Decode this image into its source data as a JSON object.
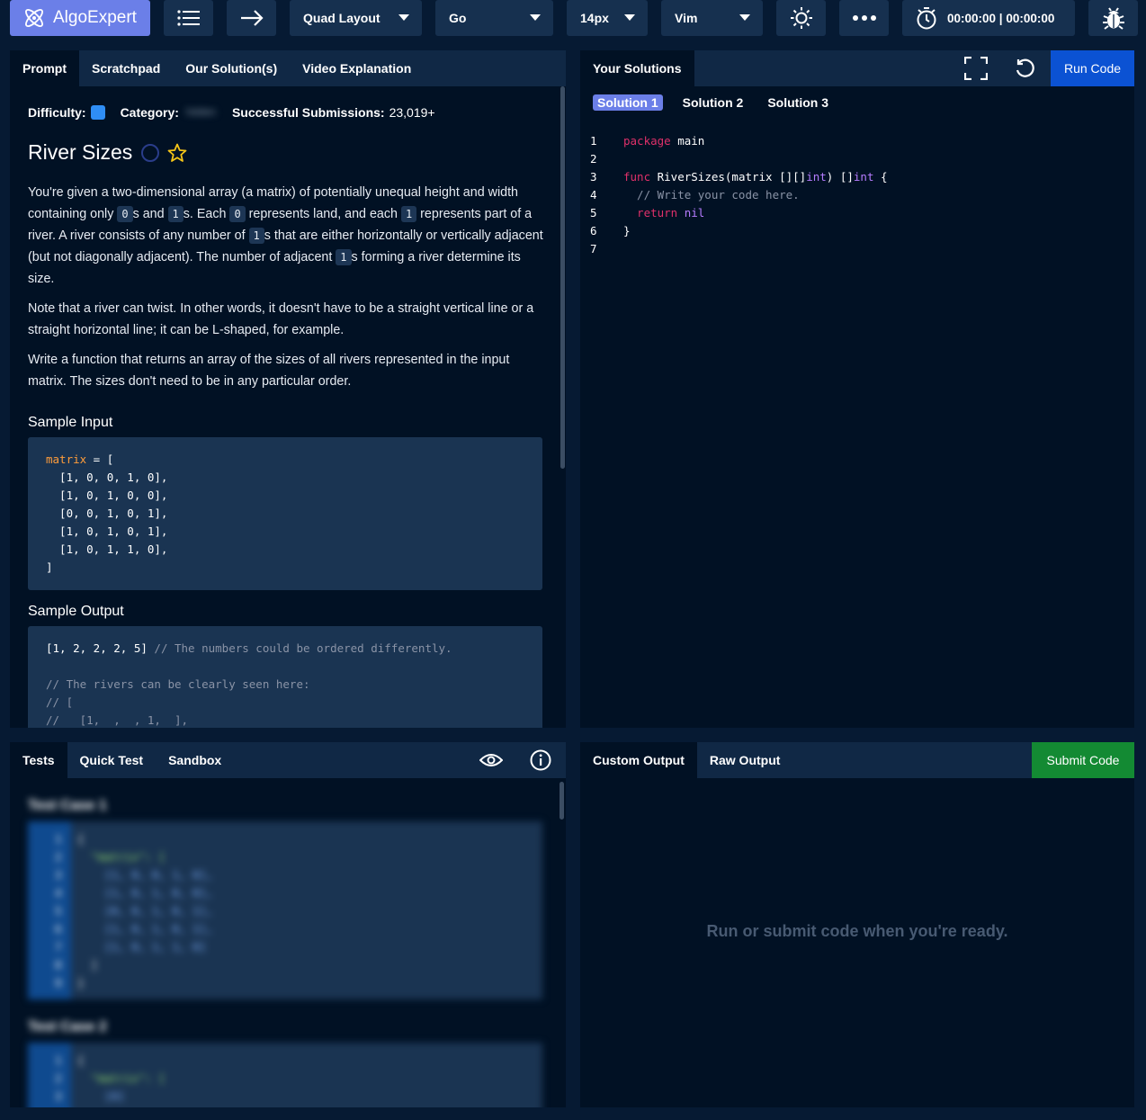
{
  "topbar": {
    "logo": "AlgoExpert",
    "layout": "Quad Layout",
    "language": "Go",
    "font_size": "14px",
    "keymap": "Vim",
    "timer": "00:00:00 | 00:00:00"
  },
  "prompt_panel": {
    "tabs": [
      "Prompt",
      "Scratchpad",
      "Our Solution(s)",
      "Video Explanation"
    ],
    "difficulty_label": "Difficulty:",
    "category_label": "Category:",
    "category_value": "hidden",
    "submissions_label": "Successful Submissions:",
    "submissions_value": "23,019+",
    "title": "River Sizes",
    "p1": {
      "a": "You're given a two-dimensional array (a matrix) of potentially unequal height and width containing only ",
      "c0": "0",
      "b": "s and ",
      "c1": "1",
      "c": "s. Each ",
      "c2": "0",
      "d": " represents land, and each ",
      "c3": "1",
      "e": " represents part of a river. A river consists of any number of ",
      "c4": "1",
      "f": "s that are either horizontally or vertically adjacent (but not diagonally adjacent). The number of adjacent ",
      "c5": "1",
      "g": "s forming a river determine its size."
    },
    "p2": "Note that a river can twist. In other words, it doesn't have to be a straight vertical line or a straight horizontal line; it can be L-shaped, for example.",
    "p3": "Write a function that returns an array of the sizes of all rivers represented in the input matrix. The sizes don't need to be in any particular order.",
    "sample_input_heading": "Sample Input",
    "sample_input": {
      "var": "matrix",
      "eq": " = [",
      "rows": [
        "  [1, 0, 0, 1, 0],",
        "  [1, 0, 1, 0, 0],",
        "  [0, 0, 1, 0, 1],",
        "  [1, 0, 1, 0, 1],",
        "  [1, 0, 1, 1, 0],"
      ],
      "close": "]"
    },
    "sample_output_heading": "Sample Output",
    "sample_output": {
      "line1_code": "[1, 2, 2, 2, 5]",
      "line1_comment": " // The numbers could be ordered differently.",
      "comments": [
        "// The rivers can be clearly seen here:",
        "// [",
        "//   [1,  ,  , 1,  ],"
      ]
    }
  },
  "solutions_panel": {
    "tab": "Your Solutions",
    "run_label": "Run Code",
    "solution_tabs": [
      "Solution 1",
      "Solution 2",
      "Solution 3"
    ],
    "line_numbers": [
      "1",
      "2",
      "3",
      "4",
      "5",
      "6",
      "7"
    ],
    "code": {
      "l1_kw": "package",
      "l1_rest": " main",
      "l3_kw": "func",
      "l3_a": " RiverSizes(matrix [][]",
      "l3_type1": "int",
      "l3_b": ") []",
      "l3_type2": "int",
      "l3_c": " {",
      "l4_comment": "  // Write your code here.",
      "l5_kw": "  return",
      "l5_val": " nil",
      "l6": "}"
    }
  },
  "tests_panel": {
    "tabs": [
      "Tests",
      "Quick Test",
      "Sandbox"
    ],
    "case1_label": "Test Case 1",
    "case2_label": "Test Case 2",
    "case1_lines": [
      "1",
      "2",
      "3",
      "4",
      "5",
      "6",
      "7",
      "8",
      "9"
    ],
    "case1_code": [
      "{",
      "  \"matrix\": [",
      "    [1, 0, 0, 1, 0],",
      "    [1, 0, 1, 0, 0],",
      "    [0, 0, 1, 0, 1],",
      "    [1, 0, 1, 0, 1],",
      "    [1, 0, 1, 1, 0]",
      "  ]",
      "}"
    ],
    "case2_lines": [
      "1",
      "2",
      "3"
    ],
    "case2_code": [
      "{",
      "  \"matrix\": [",
      "    [0]"
    ]
  },
  "output_panel": {
    "tabs": [
      "Custom Output",
      "Raw Output"
    ],
    "submit_label": "Submit Code",
    "empty_message": "Run or submit code when you're ready."
  },
  "colors": {
    "background": "#061a33",
    "panel": "#011124",
    "logo": "#6b7fe8",
    "run_button": "#0b52d3",
    "submit_button": "#138a33",
    "keyword": "#e0306a",
    "type": "#b57cff",
    "comment": "#8a93a6",
    "star": "#f5c518"
  }
}
